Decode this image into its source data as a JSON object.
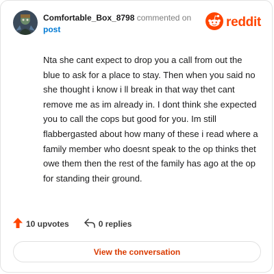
{
  "header": {
    "username": "Comfortable_Box_8798",
    "commented_on": "commented on",
    "post_link": "post",
    "logo_text": "reddit"
  },
  "comment": {
    "body": "Nta she cant expect to drop you a call from out the blue to ask for a place to stay. Then when you said no she thought i know i ll break in that way thet cant remove me as im already in. I dont think she expected you to call the cops but good for you. Im still flabbergasted about how many of these i read where a family member who doesnt speak to the op thinks thet owe them then the rest of the family has ago at the op for standing their ground."
  },
  "actions": {
    "upvotes": "10 upvotes",
    "replies": "0 replies"
  },
  "view_button": {
    "label": "View the conversation"
  },
  "colors": {
    "brand": "#ff4500",
    "link": "#0079d3",
    "button_text": "#d93a00"
  }
}
